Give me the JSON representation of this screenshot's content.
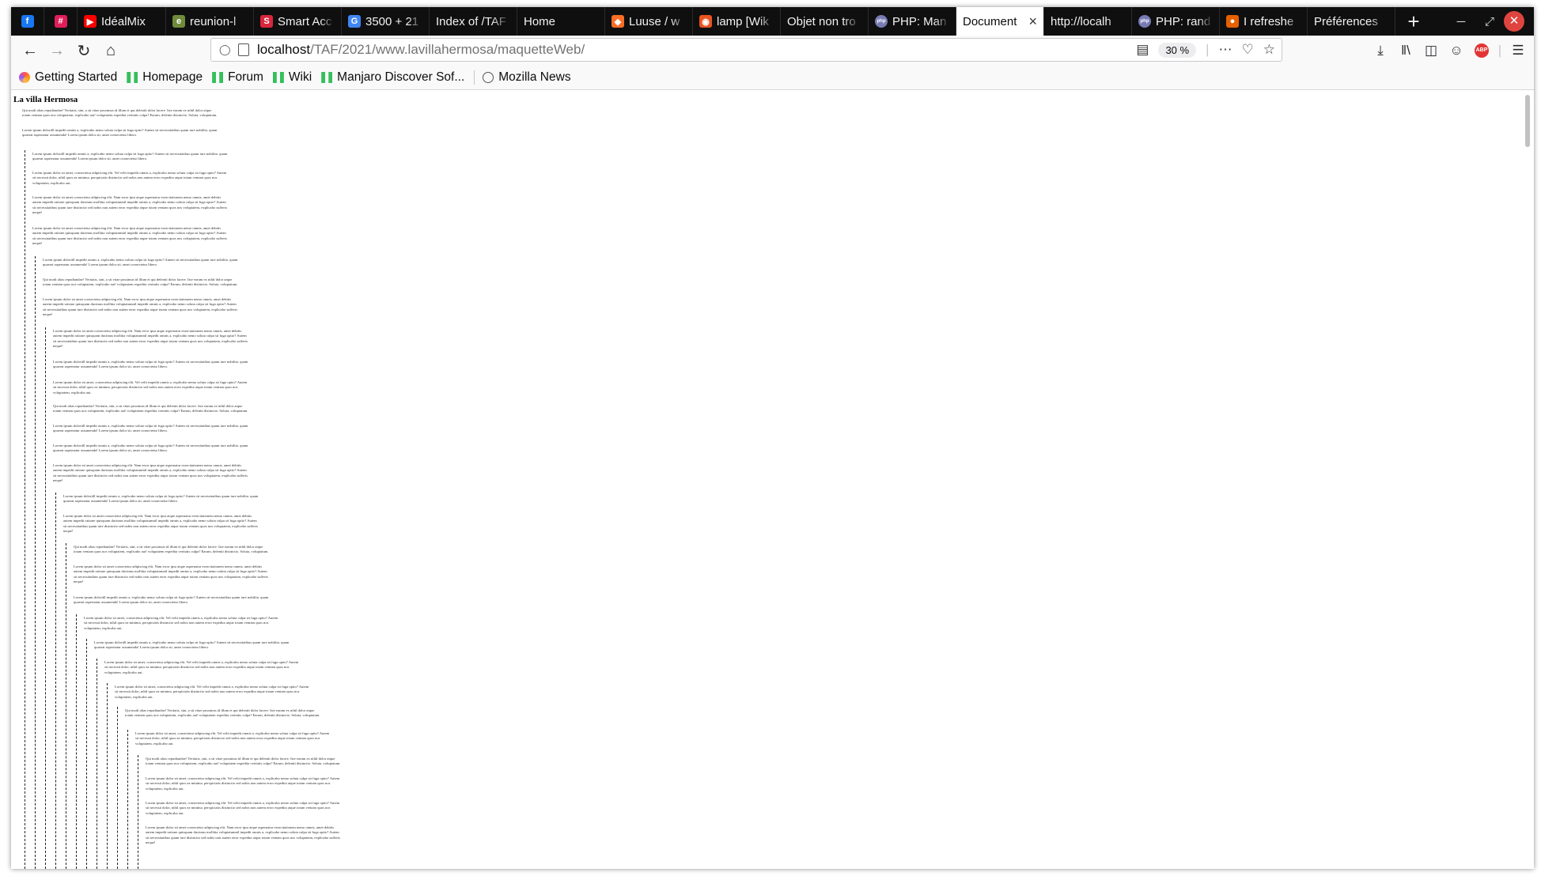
{
  "browser": {
    "tabs": [
      {
        "title": "",
        "icon": "facebook-icon",
        "color": "#1877f2",
        "pinned": true,
        "glyph": "f"
      },
      {
        "title": "",
        "icon": "slack-icon",
        "color": "#e01e5a",
        "pinned": true,
        "glyph": "#"
      },
      {
        "title": "IdéalMix",
        "icon": "youtube-icon",
        "color": "#ff0000",
        "glyph": "▶"
      },
      {
        "title": "reunion-l",
        "icon": "etherpad-icon",
        "color": "#6f8b3a",
        "glyph": "e"
      },
      {
        "title": "Smart Acc",
        "icon": "smart-account-icon",
        "color": "#d7263d",
        "glyph": "S"
      },
      {
        "title": "3500 + 21",
        "icon": "google-icon",
        "color": "#4285f4",
        "glyph": "G"
      },
      {
        "title": "Index of /TAF",
        "icon": "",
        "color": "",
        "glyph": ""
      },
      {
        "title": "Home",
        "icon": "",
        "color": "",
        "glyph": ""
      },
      {
        "title": "Luuse / w",
        "icon": "gitlab-icon",
        "color": "#fc6d26",
        "glyph": "◆"
      },
      {
        "title": "lamp [Wik",
        "icon": "ubuntu-icon",
        "color": "#e95420",
        "glyph": "◉"
      },
      {
        "title": "Objet non tro",
        "icon": "",
        "color": "",
        "glyph": ""
      },
      {
        "title": "PHP: Man",
        "icon": "php-icon",
        "color": "#777bb3",
        "glyph": "php"
      },
      {
        "title": "Document",
        "icon": "",
        "color": "",
        "glyph": "",
        "active": true
      },
      {
        "title": "http://localh",
        "icon": "",
        "color": "",
        "glyph": ""
      },
      {
        "title": "PHP: rand",
        "icon": "php-icon",
        "color": "#777bb3",
        "glyph": "php"
      },
      {
        "title": "I refreshe",
        "icon": "firefox-icon",
        "color": "#e66000",
        "glyph": "●"
      },
      {
        "title": "Préférences",
        "icon": "",
        "color": "",
        "glyph": ""
      }
    ],
    "url_host": "localhost",
    "url_path": "/TAF/2021/www.lavillahermosa/maquetteWeb/",
    "zoom": "30 %",
    "bookmarks": [
      {
        "label": "Getting Started",
        "icon": "firefox-icon"
      },
      {
        "label": "Homepage",
        "icon": "manjaro-icon"
      },
      {
        "label": "Forum",
        "icon": "manjaro-icon"
      },
      {
        "label": "Wiki",
        "icon": "manjaro-icon"
      },
      {
        "label": "Manjaro Discover Sof...",
        "icon": "manjaro-icon"
      },
      {
        "label": "Mozilla News",
        "icon": "globe-icon"
      }
    ]
  },
  "page": {
    "title": "La villa Hermosa",
    "texts": {
      "a": "Qui modi alias repudiandae! Veritatis, sint, a sit vitae possimus id illum et qui deleniti dolor facere. Iste earum ex nihil dolor atque totam veniam quos nos voluptatem, explicabo aut! voluptatem expedita veritatis culpa? Earum, deleniti distinctio. Soluta, voluptatum.",
      "b": "Lorem ipsum dolor sit amet consectetur adipiscing elit. Nam error ipsa atque aspernatur exercitationem nemo omnis, amet debitis autem impedit ratione quisquam ducimus mollitia voluptatumnil impedit omnis a, explicabo nemo soluta culpa sit fuga optio? Autem sit necessitatibus quam iure distinctio sed nobis non autem error expedita atque totam veniam quos nos voluptatem, explicabo sufferts neque!",
      "c": "Lorem ipsum doloriill impedit omnis a, explicabo nemo soluta culpa sit fuga optio? Autem sit necessitatibus quam iure nobilita. quam quaerat aspernatur assumenda! Lorem ipsum dolor sit, amet consectetur libero.",
      "d": "Lorem ipsum dolor sit amet, consectetur adipiscing elit. Vel velit impedit omnis a, explicabo nemo soluta culpa sit fuga optio? Autem sit necessit dolor, nihil quos ea minima. perspiciatis distinctio sed nobis non autem error expedita atque totam veniam quos nos voluptatem, explicabo aut."
    }
  }
}
